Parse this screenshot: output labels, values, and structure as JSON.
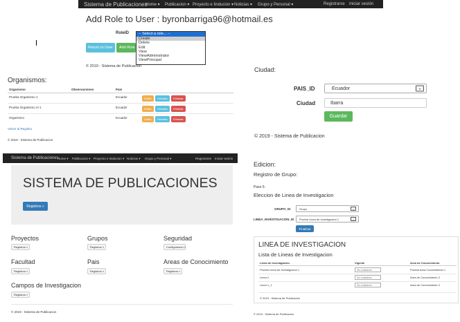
{
  "p1": {
    "nav": {
      "brand": "Sistema de Publicaciones",
      "items": [
        "Home ▾",
        "Publicacion ▾",
        "Proyecto e Iinducion ▾",
        "Noticias ▾",
        "Grupo y Personal ▾"
      ],
      "register": "Registrarse",
      "login": "Iniciar sesión"
    },
    "title": "Add Role to User : byronbarriga96@hotmail.es",
    "role_label": "RoleID",
    "select_current": "-- Select a role... --",
    "options": [
      "Create",
      "Delete",
      "Edit",
      "View",
      "ViewAdministrator",
      "ViewPrincipal"
    ],
    "return_btn": "Return to User",
    "add_btn": "Add Role",
    "footer": "© 2019 - Sistema de Publicacion"
  },
  "p2": {
    "title": "Organismos:",
    "headers": [
      "Organismo",
      "Observaciones",
      "Pais"
    ],
    "rows": [
      {
        "organismo": "Prueba Organismo 1",
        "obs": "",
        "pais": "Ecuador"
      },
      {
        "organismo": "Prueba Organismo 2+1",
        "obs": "",
        "pais": "Ecuador"
      },
      {
        "organismo": "Organismo",
        "obs": "",
        "pais": "Ecuador"
      }
    ],
    "edit": "Editar",
    "details": "Detalles",
    "delete": "Eliminar",
    "back": "Volver al Registro",
    "footer": "© 2019 - Sistema de Publicacion"
  },
  "p3": {
    "title": "Ciudad:",
    "pais_label": "PAIS_ID",
    "pais_value": "Ecuador",
    "ciudad_label": "Ciudad",
    "ciudad_value": "Ibarra",
    "save": "Guardar",
    "footer": "© 2019 - Sistema de Publicacion"
  },
  "p4": {
    "nav": {
      "brand": "Sistema de Publicaciones",
      "items": [
        "Home ▾",
        "Publicacion ▾",
        "Proyecto e Iinducion ▾",
        "Noticias ▾",
        "Grupo y Personal ▾"
      ],
      "register": "Registrarse",
      "login": "Iniciar sesión"
    },
    "hero": "SISTEMA DE PUBLICACIONES",
    "hero_btn": "Registros »",
    "sections": [
      {
        "title": "Proyectos",
        "btn": "Registros »"
      },
      {
        "title": "Grupos",
        "btn": "Registros »"
      },
      {
        "title": "Seguridad",
        "btn": "Configuracion »"
      },
      {
        "title": "Facultad",
        "btn": "Registros »"
      },
      {
        "title": "Pais",
        "btn": "Registros »"
      },
      {
        "title": "Areas de Conocimiento",
        "btn": "Registros »"
      },
      {
        "title": "Campos de Investigacion",
        "btn": "Registros »"
      }
    ],
    "footer": "© 2019 - Sistema de Publicacion"
  },
  "p5": {
    "title": "Edicion:",
    "subtitle": "Registro de Grupo:",
    "step": "Paso 5:",
    "step_title": "Eleccion de Linea de Investigacion",
    "grupo_label": "GRUPO_ID",
    "grupo_value": "Grupo",
    "linea_label": "LINEA_INVESTIGACION_ID",
    "linea_value": "Prueba Linea de Investigacion 1",
    "finish": "Finalizar",
    "panel_title": "LINEA DE INVESTIGACION",
    "panel_subtitle": "Lista de Lineas de Investigacion",
    "headers": [
      "Linea de Investigación",
      "Vigente",
      "Area de Conocimiento"
    ],
    "rows": [
      {
        "linea": "Prueba Linea de Investigacion 1",
        "vigente": "Sin establecer",
        "area": "Prueba Area Conocimiento 1"
      },
      {
        "linea": "Linea 2",
        "vigente": "Sin establecer",
        "area": "Area de Conocimiento 2"
      },
      {
        "linea": "Linea 1_1",
        "vigente": "Sin establecer",
        "area": "Area de Conocimiento 2"
      }
    ],
    "panel_footer": "© 2019 - Sistema de Publicacion",
    "footer": "© 2019 - Sistema de Publicacion"
  },
  "colors": {
    "nav": "#222222",
    "primary": "#337ab7",
    "info": "#5bc0de",
    "success": "#5cb85c",
    "danger": "#d9534f",
    "warning": "#f0ad4e",
    "jumbotron": "#eeeeee"
  }
}
